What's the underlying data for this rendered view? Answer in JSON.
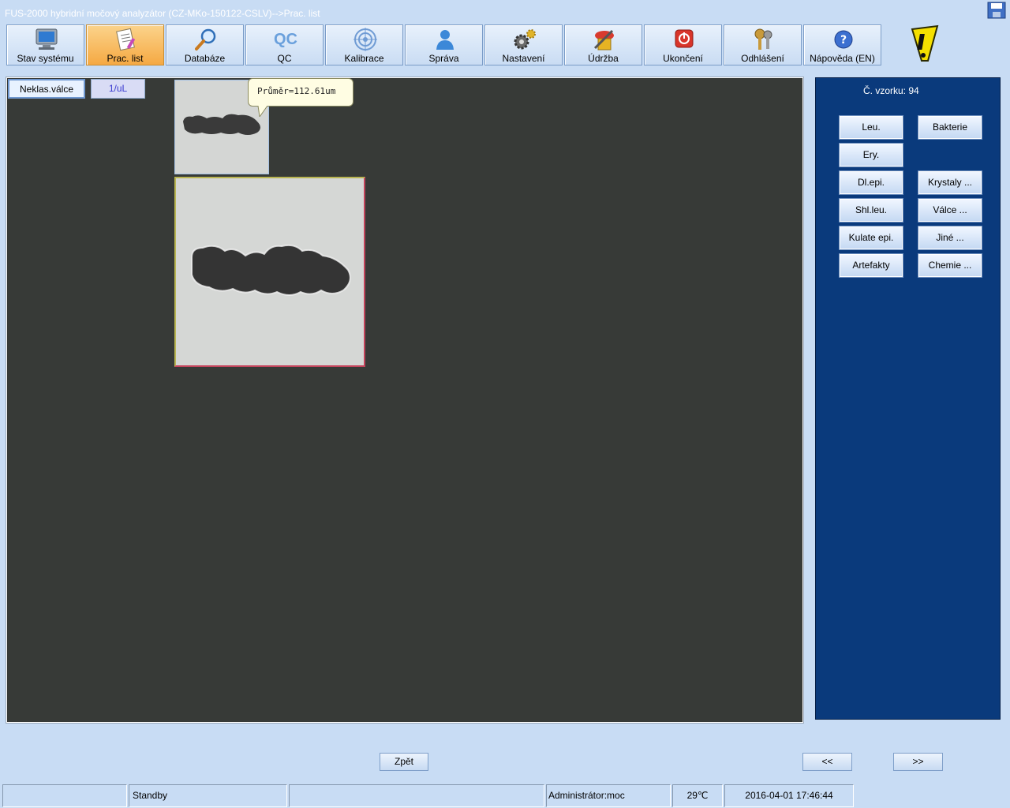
{
  "window": {
    "title": "FUS-2000 hybridní močový analyzátor (CZ-MKo-150122-CSLV)-->Prac. list"
  },
  "toolbar": {
    "buttons": [
      {
        "label": "Stav systému",
        "icon": "monitor-icon"
      },
      {
        "label": "Prac. list",
        "icon": "worklist-icon",
        "active": true
      },
      {
        "label": "Databáze",
        "icon": "magnifier-icon"
      },
      {
        "label": "QC",
        "icon": "qc-icon"
      },
      {
        "label": "Kalibrace",
        "icon": "target-icon"
      },
      {
        "label": "Správa",
        "icon": "user-icon"
      },
      {
        "label": "Nastavení",
        "icon": "gears-icon"
      },
      {
        "label": "Údržba",
        "icon": "maintenance-icon"
      },
      {
        "label": "Ukončení",
        "icon": "power-icon"
      },
      {
        "label": "Odhlášení",
        "icon": "keys-icon"
      },
      {
        "label": "Nápověda (EN)",
        "icon": "help-icon"
      }
    ],
    "qc_icon_text": "QC"
  },
  "viewer": {
    "category_button": "Neklas.válce",
    "unit_button": "1/uL",
    "tooltip": "Průměr=112.61um"
  },
  "panel": {
    "sample_label": "Č. vzorku: 94",
    "buttons": {
      "leu": "Leu.",
      "bakterie": "Bakterie",
      "ery": "Ery.",
      "dlepi": "Dl.epi.",
      "krystaly": "Krystaly ...",
      "shlleu": "Shl.leu.",
      "valce": "Válce ...",
      "kulate": "Kulate epi.",
      "jine": "Jiné ...",
      "artefakty": "Artefakty",
      "chemie": "Chemie ..."
    }
  },
  "nav": {
    "back": "Zpět",
    "prev": "<<",
    "next": ">>"
  },
  "status": {
    "cell1": "",
    "state": "Standby",
    "cell3": "",
    "user": "Administrátor:moc",
    "temperature": "29℃",
    "datetime": "2016-04-01 17:46:44"
  },
  "colors": {
    "background": "#c8dcf4",
    "viewer_bg": "#373a37",
    "panel_bg": "#0a3a7c",
    "active_tab": "#f5a943"
  }
}
